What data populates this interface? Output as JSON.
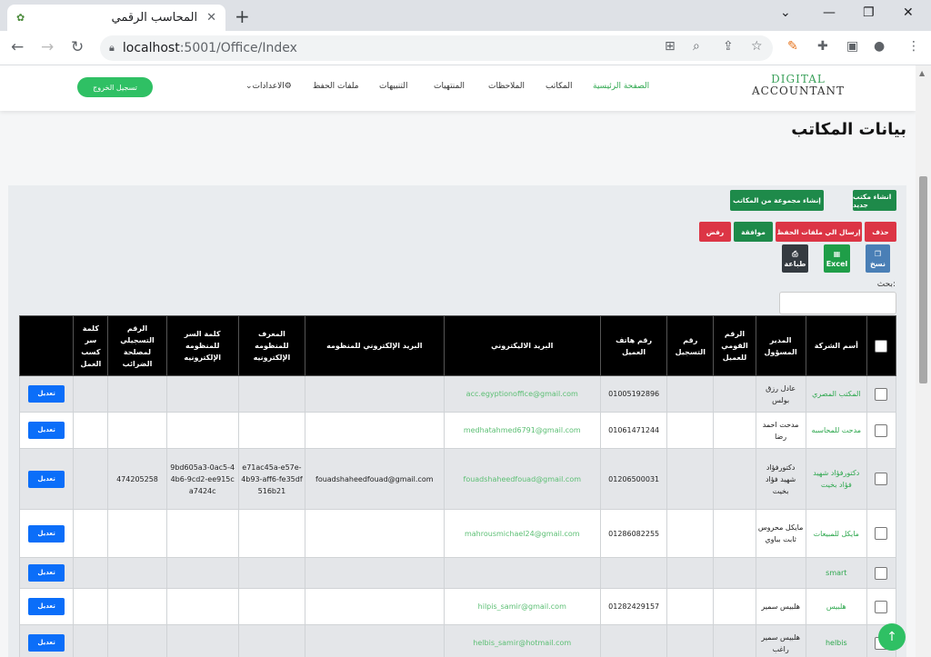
{
  "browser": {
    "tab_title": "المحاسب الرقمي",
    "url_host": "localhost",
    "url_rest": ":5001/Office/Index"
  },
  "navbar": {
    "logo_line1": "DIGITAL",
    "logo_line2": "ACCOUNTANT",
    "items": [
      "الصفحة الرئيسية",
      "المكاتب",
      "الملاحظات",
      "المنتهيات",
      "التنبيهات",
      "ملفات الحفظ",
      "الاعدادات"
    ],
    "logout": "تسجيل الخروج"
  },
  "page_title": "بيانات المكاتب",
  "toolbar": {
    "new_office": "انشاء مكتب جديد",
    "new_group": "إنشاء مجموعة من المكاتب",
    "delete": "حذف",
    "send_to_archive": "إرسال الي ملفات الحفظ",
    "approve": "موافقة",
    "reject": "رفض",
    "copy": "نسخ",
    "excel": "Excel",
    "print": "طباعة"
  },
  "search": {
    "label": "بحث:",
    "value": ""
  },
  "table": {
    "headers": [
      "أسم الشركة",
      "المدير المسؤول",
      "الرقم القومي للعميل",
      "رقم التسجيل",
      "رقم هاتف العميل",
      "البريد الاليكتروني",
      "البريد الإلكتروني للمنظومه",
      "المعرف للمنظومه الإلكترونيه",
      "كلمة السر للمنظومه الإلكترونيه",
      "الرقم التسجيلي لمصلحة الضرائب",
      "كلمة سر كسب العمل",
      ""
    ],
    "edit_label": "تعديل",
    "rows": [
      {
        "company": "المكتب المصري",
        "manager": "عادل رزق بولس",
        "national_id": "",
        "reg_no": "",
        "phone": "01005192896",
        "email": "acc.egyptionoffice@gmail.com",
        "sys_email": "",
        "sys_id": "",
        "sys_pass": "",
        "tax_no": "",
        "earn_pass": ""
      },
      {
        "company": "مدحت للمحاسبه",
        "manager": "مدحت احمد رضا",
        "national_id": "",
        "reg_no": "",
        "phone": "01061471244",
        "email": "medhatahmed6791@gmail.com",
        "sys_email": "",
        "sys_id": "",
        "sys_pass": "",
        "tax_no": "",
        "earn_pass": ""
      },
      {
        "company": "دكتورفؤاد شهيد فؤاد بخيت",
        "manager": "دكتورفؤاد شهيد فؤاد بخيت",
        "national_id": "",
        "reg_no": "",
        "phone": "01206500031",
        "email": "fouadshaheedfouad@gmail.com",
        "sys_email": "fouadshaheedfouad@gmail.com",
        "sys_id": "e71ac45a-e57e-4b93-aff6-fe35df516b21",
        "sys_pass": "9bd605a3-0ac5-44b6-9cd2-ee915ca7424c",
        "tax_no": "474205258",
        "earn_pass": ""
      },
      {
        "company": "مايكل للمبيعات",
        "manager": "مايكل محروس ثابت بباوي",
        "national_id": "",
        "reg_no": "",
        "phone": "01286082255",
        "email": "mahrousmichael24@gmail.com",
        "sys_email": "",
        "sys_id": "",
        "sys_pass": "",
        "tax_no": "",
        "earn_pass": ""
      },
      {
        "company": "smart",
        "manager": "",
        "national_id": "",
        "reg_no": "",
        "phone": "",
        "email": "",
        "sys_email": "",
        "sys_id": "",
        "sys_pass": "",
        "tax_no": "",
        "earn_pass": ""
      },
      {
        "company": "هلبيس",
        "manager": "هلبيس سمير",
        "national_id": "",
        "reg_no": "",
        "phone": "01282429157",
        "email": "hilpis_samir@gmail.com",
        "sys_email": "",
        "sys_id": "",
        "sys_pass": "",
        "tax_no": "",
        "earn_pass": ""
      },
      {
        "company": "helbis",
        "manager": "هلبيس سمير راغب",
        "national_id": "",
        "reg_no": "",
        "phone": "",
        "email": "helbis_samir@hotmail.com",
        "sys_email": "",
        "sys_id": "",
        "sys_pass": "",
        "tax_no": "",
        "earn_pass": ""
      }
    ]
  },
  "colors": {
    "accent_green": "#2fa84f",
    "dark_green": "#1e8a4a",
    "danger": "#dc3545",
    "primary": "#0b6ef9"
  }
}
